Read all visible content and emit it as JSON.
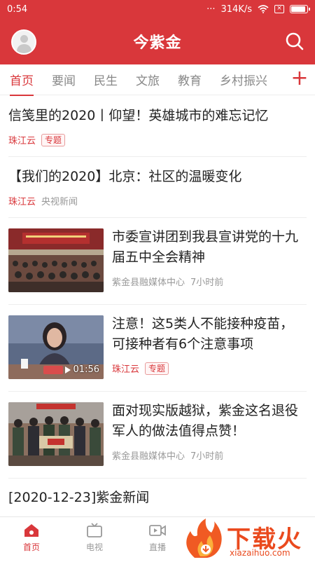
{
  "status": {
    "time": "0:54",
    "dots": "···",
    "speed": "314K/s",
    "sim": "×"
  },
  "header": {
    "title": "今紫金"
  },
  "tabs": [
    "首页",
    "要闻",
    "民生",
    "文旅",
    "教育",
    "乡村振兴"
  ],
  "tab_add": "+",
  "feed": {
    "items": [
      {
        "title": "信笺里的2020丨仰望！英雄城市的难忘记忆",
        "source": "珠江云",
        "tag": "专题"
      },
      {
        "title": "【我们的2020】北京：社区的温暖变化",
        "source": "珠江云",
        "source2": "央视新闻"
      },
      {
        "title": "市委宣讲团到我县宣讲党的十九届五中全会精神",
        "source": "紫金县融媒体中心",
        "time": "7小时前"
      },
      {
        "title": "注意！这5类人不能接种疫苗，可接种者有6个注意事项",
        "source": "珠江云",
        "tag": "专题",
        "duration": "01:56"
      },
      {
        "title": "面对现实版越狱，紫金这名退役军人的做法值得点赞！",
        "source": "紫金县融媒体中心",
        "time": "7小时前"
      }
    ],
    "last_title": "[2020-12-23]紫金新闻"
  },
  "bottom_nav": [
    "首页",
    "电视",
    "直播"
  ],
  "watermark": {
    "main": "下载火",
    "sub": "xiazaihuo.com"
  },
  "colors": {
    "accent": "#d9373b"
  }
}
